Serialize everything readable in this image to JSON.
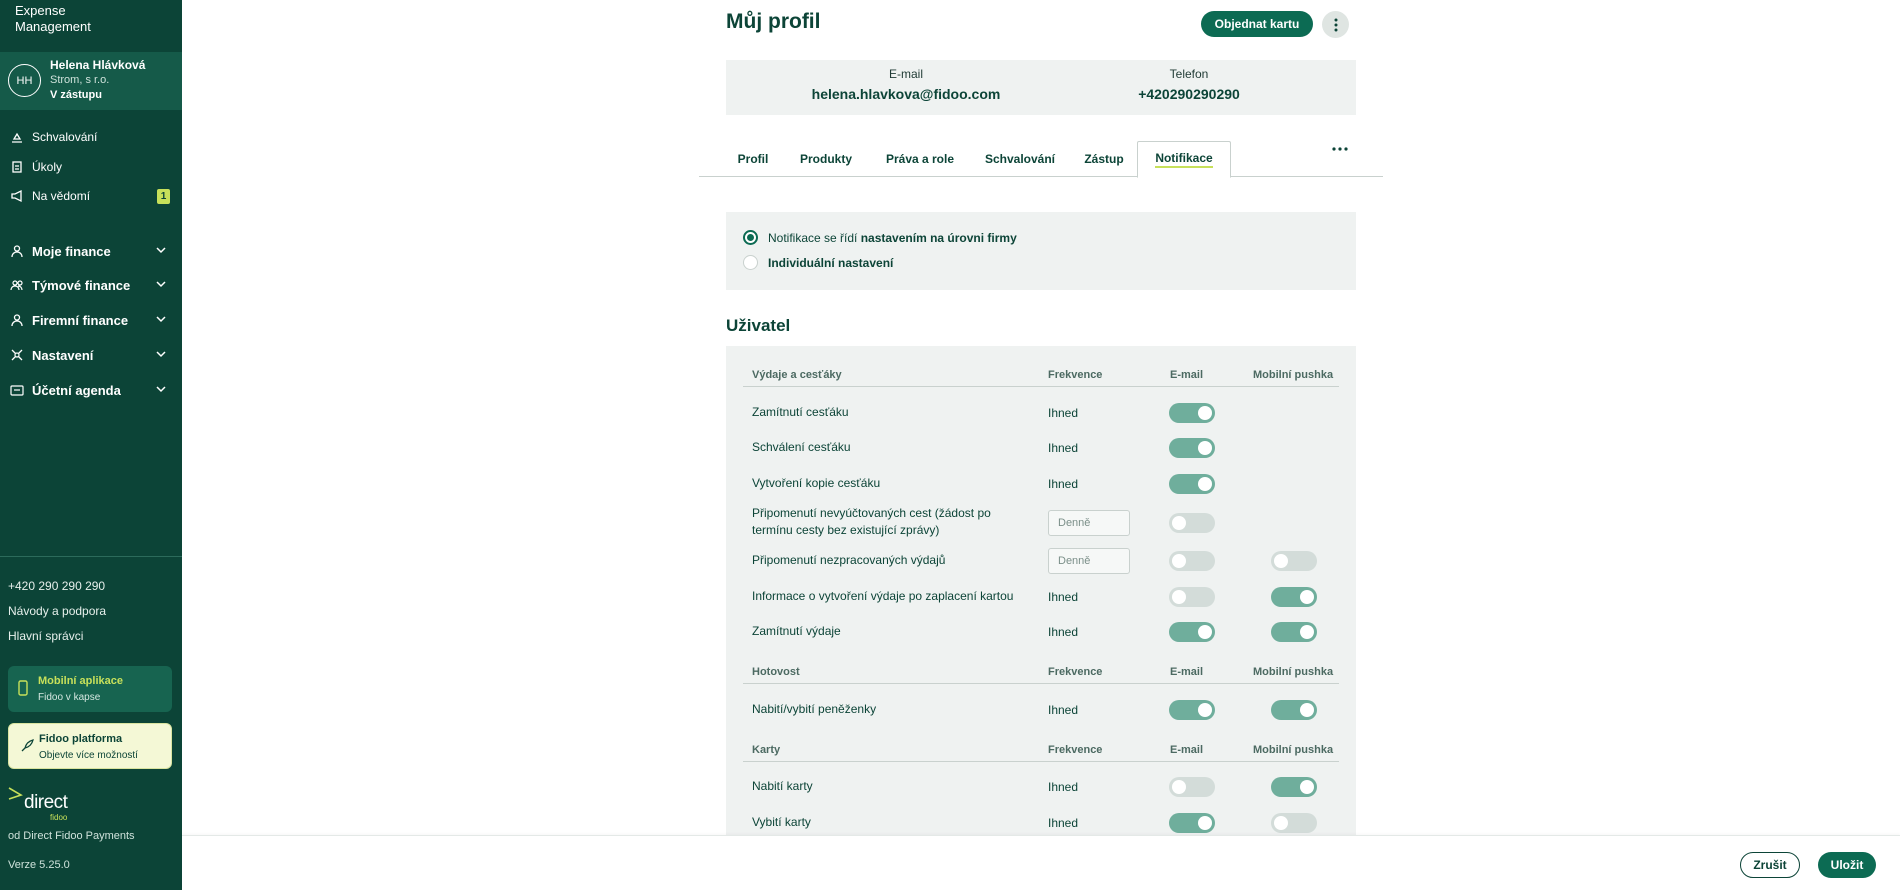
{
  "sidebar": {
    "brand": {
      "line1": "Expense",
      "line2": "Management"
    },
    "user": {
      "initials": "HH",
      "name": "Helena Hlávková",
      "company": "Strom, s r.o.",
      "status": "V zástupu"
    },
    "top_items": [
      {
        "label": "Schvalování",
        "icon": "approval-icon"
      },
      {
        "label": "Úkoly",
        "icon": "tasks-icon"
      },
      {
        "label": "Na vědomí",
        "icon": "megaphone-icon",
        "badge": "1"
      }
    ],
    "groups": [
      {
        "label": "Moje finance",
        "icon": "person-icon"
      },
      {
        "label": "Týmové finance",
        "icon": "team-icon"
      },
      {
        "label": "Firemní finance",
        "icon": "company-icon"
      },
      {
        "label": "Nastavení",
        "icon": "settings-icon"
      },
      {
        "label": "Účetní agenda",
        "icon": "accounting-icon"
      }
    ],
    "phone": "+420 290 290 290",
    "help": "Návody a podpora",
    "admins": "Hlavní správci",
    "promo_mobile": {
      "title": "Mobilní aplikace",
      "subtitle": "Fidoo v kapse"
    },
    "promo_platform": {
      "title": "Fidoo platforma",
      "subtitle": "Objevte více možností"
    },
    "logo": {
      "main": "direct",
      "sub": "fidoo"
    },
    "provider": "od Direct Fidoo Payments",
    "version": "Verze 5.25.0"
  },
  "header": {
    "title": "Můj profil",
    "order_card": "Objednat kartu"
  },
  "contact": {
    "email_label": "E-mail",
    "email": "helena.hlavkova@fidoo.com",
    "phone_label": "Telefon",
    "phone": "+420290290290"
  },
  "tabs": [
    "Profil",
    "Produkty",
    "Práva a role",
    "Schvalování",
    "Zástup",
    "Notifikace"
  ],
  "active_tab": "Notifikace",
  "notification_mode": {
    "option1_prefix": "Notifikace se řídí ",
    "option1_bold": "nastavením na úrovni firmy",
    "option2": "Individuální nastavení",
    "selected": 1
  },
  "section_title": "Uživatel",
  "columns": {
    "frequency": "Frekvence",
    "email": "E-mail",
    "push": "Mobilní pushka"
  },
  "groups": [
    {
      "title": "Výdaje a cesťáky",
      "rows": [
        {
          "name": "Zamítnutí cesťáku",
          "freq": "Ihned",
          "email": true,
          "push": null
        },
        {
          "name": "Schválení cesťáku",
          "freq": "Ihned",
          "email": true,
          "push": null
        },
        {
          "name": "Vytvoření kopie cesťáku",
          "freq": "Ihned",
          "email": true,
          "push": null
        },
        {
          "name": "Připomenutí nevyúčtovaných cest (žádost po",
          "name2": "termínu cesty bez existující zprávy)",
          "freq_input": "Denně",
          "email": false,
          "push": null
        },
        {
          "name": "Připomenutí nezpracovaných výdajů",
          "freq_input": "Denně",
          "email": false,
          "push": false
        },
        {
          "name": "Informace o vytvoření výdaje po zaplacení kartou",
          "freq": "Ihned",
          "email": false,
          "push": true
        },
        {
          "name": "Zamítnutí výdaje",
          "freq": "Ihned",
          "email": true,
          "push": true
        }
      ]
    },
    {
      "title": "Hotovost",
      "rows": [
        {
          "name": "Nabití/vybití peněženky",
          "freq": "Ihned",
          "email": true,
          "push": true
        }
      ]
    },
    {
      "title": "Karty",
      "rows": [
        {
          "name": "Nabití karty",
          "freq": "Ihned",
          "email": false,
          "push": true
        },
        {
          "name": "Vybití karty",
          "freq": "Ihned",
          "email": true,
          "push": false
        }
      ]
    }
  ],
  "footer": {
    "cancel": "Zrušit",
    "save": "Uložit"
  },
  "colors": {
    "sidebar": "#0c4437",
    "accent": "#0c6b53",
    "highlight": "#c7e05a",
    "toggle_on": "#6fae9c",
    "toggle_off": "#d3dcd9",
    "panel": "#eff2f1"
  }
}
